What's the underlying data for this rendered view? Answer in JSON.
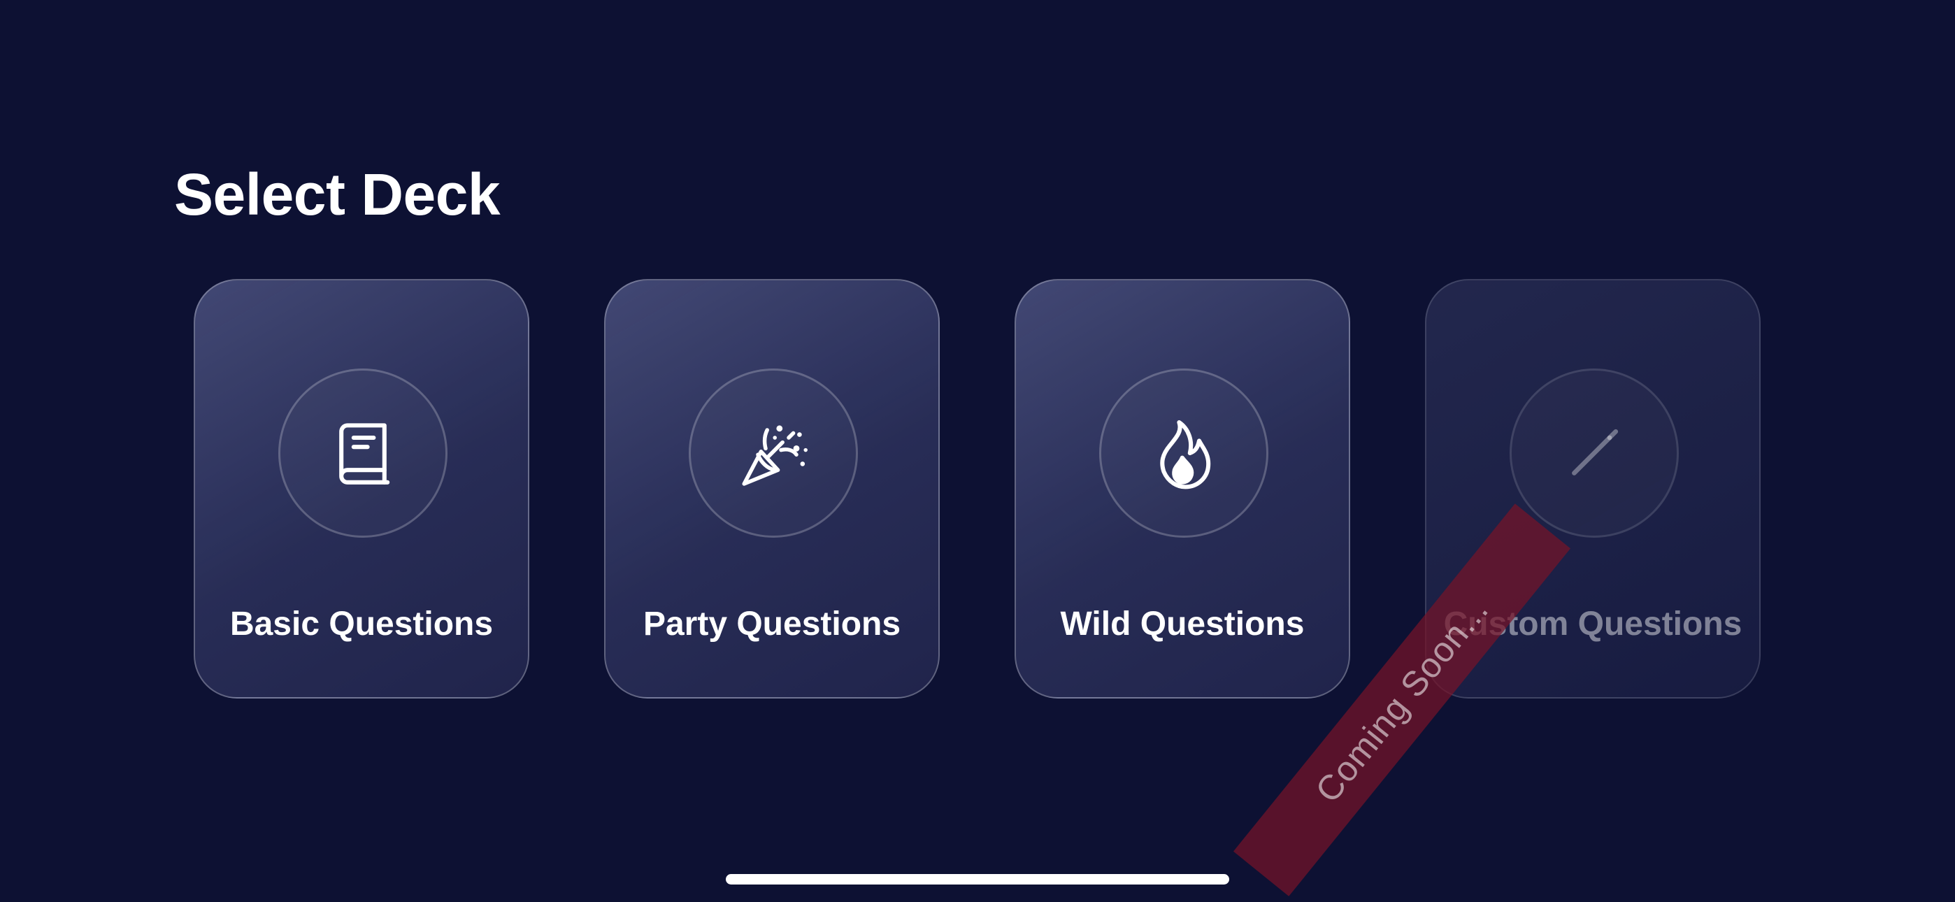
{
  "title": "Select Deck",
  "decks": [
    {
      "label": "Basic Questions",
      "icon": "book-icon",
      "enabled": true
    },
    {
      "label": "Party Questions",
      "icon": "party-popper-icon",
      "enabled": true
    },
    {
      "label": "Wild Questions",
      "icon": "flame-icon",
      "enabled": true
    },
    {
      "label": "Custom Questions",
      "icon": "pencil-icon",
      "enabled": false,
      "ribbon": "Coming Soon..."
    }
  ],
  "colors": {
    "background": "#0d1133",
    "text": "#ffffff",
    "ribbon": "#761428"
  }
}
